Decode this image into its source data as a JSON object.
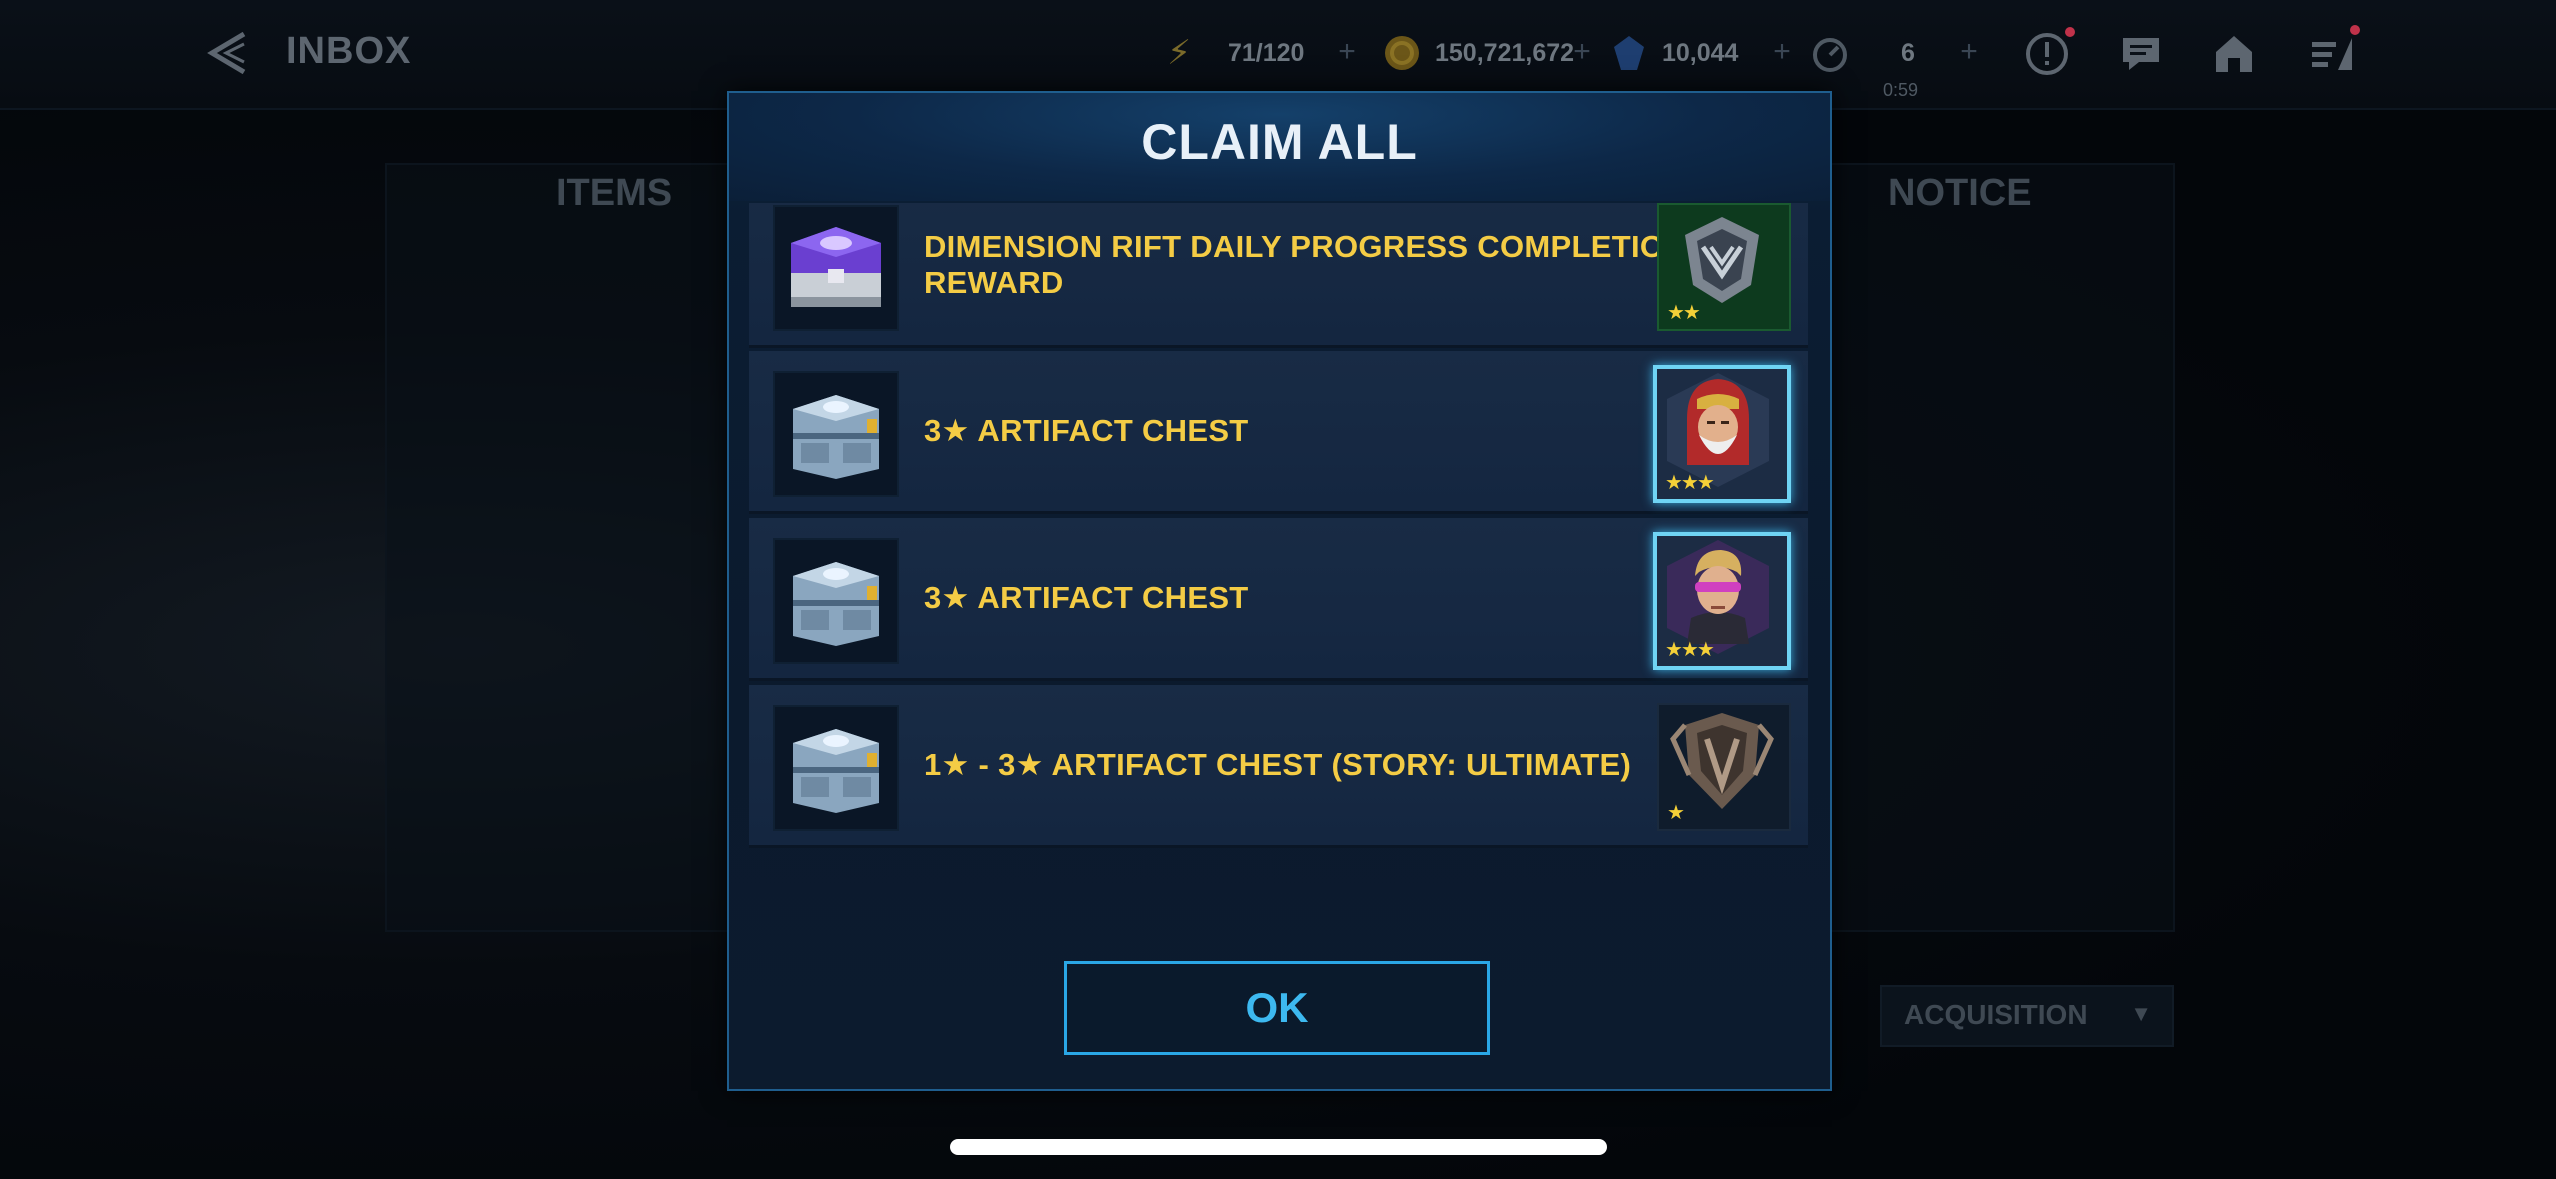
{
  "header": {
    "title": "INBOX",
    "energy": "71/120",
    "gold": "150,721,672",
    "crystals": "10,044",
    "orbs": "6",
    "timer": "0:59"
  },
  "tabs": [
    "ITEMS",
    "NOTICE"
  ],
  "filter": {
    "selected": "ACQUISITION"
  },
  "modal": {
    "title": "CLAIM ALL",
    "ok_label": "OK",
    "rows": [
      {
        "label": "DIMENSION RIFT DAILY PROGRESS COMPLETION REWARD",
        "chest": "purple-chest-icon",
        "reward": "emblem-reward-icon",
        "stars": 2
      },
      {
        "label": "3★ ARTIFACT CHEST",
        "chest": "artifact-chest-icon",
        "reward": "hero-portrait-red-hood",
        "stars": 3
      },
      {
        "label": "3★ ARTIFACT CHEST",
        "chest": "artifact-chest-icon",
        "reward": "hero-portrait-purple-visor",
        "stars": 3
      },
      {
        "label": "1★ - 3★ ARTIFACT CHEST (STORY: ULTIMATE)",
        "chest": "artifact-chest-icon",
        "reward": "bronze-emblem-icon",
        "stars": 1
      }
    ]
  },
  "colors": {
    "accent": "#2aa7e6",
    "row_label": "#f4cc45",
    "star": "#f4d038"
  }
}
